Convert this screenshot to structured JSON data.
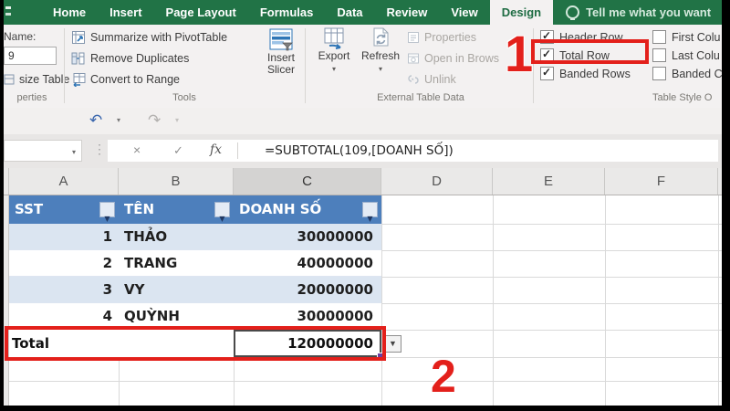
{
  "colors": {
    "excel_green": "#217346",
    "header_blue": "#4d7fbc",
    "band_blue": "#dbe5f1",
    "annotation_red": "#e3201b",
    "disabled_gray": "#a9a6a2"
  },
  "ribbon_tabs": {
    "labels": [
      "Home",
      "Insert",
      "Page Layout",
      "Formulas",
      "Data",
      "Review",
      "View"
    ],
    "active": "Design",
    "tell_me": "Tell me what you want"
  },
  "properties_group": {
    "name_label": "Name:",
    "name_value": "9",
    "resize_label": "size Table",
    "group_label": "perties"
  },
  "tools_group": {
    "summarize": "Summarize with PivotTable",
    "remove_duplicates": "Remove Duplicates",
    "convert_to_range": "Convert to Range",
    "slicer_line1": "Insert",
    "slicer_line2": "Slicer",
    "group_label": "Tools"
  },
  "external_group": {
    "export": "Export",
    "refresh": "Refresh",
    "properties": "Properties",
    "open_browser": "Open in Brows",
    "unlink": "Unlink",
    "group_label": "External Table Data"
  },
  "style_options": {
    "header_row": "Header Row",
    "total_row": "Total Row",
    "banded_rows": "Banded Rows",
    "first_column": "First Colu",
    "last_column": "Last Colu",
    "banded_columns": "Banded C",
    "group_label": "Table Style O"
  },
  "annotations": {
    "step1": "1",
    "step2": "2"
  },
  "formula_bar": {
    "name_box": "",
    "cancel": "×",
    "enter": "✓",
    "fx_label": "fx",
    "formula": "=SUBTOTAL(109,[DOANH SỐ])"
  },
  "grid": {
    "columns": [
      "A",
      "B",
      "C",
      "D",
      "E",
      "F"
    ],
    "selected_column": "C"
  },
  "table": {
    "headers": [
      "SST",
      "TÊN",
      "DOANH SỐ"
    ],
    "rows": [
      [
        "1",
        "THẢO",
        "30000000"
      ],
      [
        "2",
        "TRANG",
        "40000000"
      ],
      [
        "3",
        "VY",
        "20000000"
      ],
      [
        "4",
        "QUỲNH",
        "30000000"
      ]
    ],
    "total_label": "Total",
    "total_value": "120000000"
  },
  "icons": {
    "undo": "↶",
    "redo": "↷",
    "caret": "▾",
    "ellipsis": "⋮"
  }
}
